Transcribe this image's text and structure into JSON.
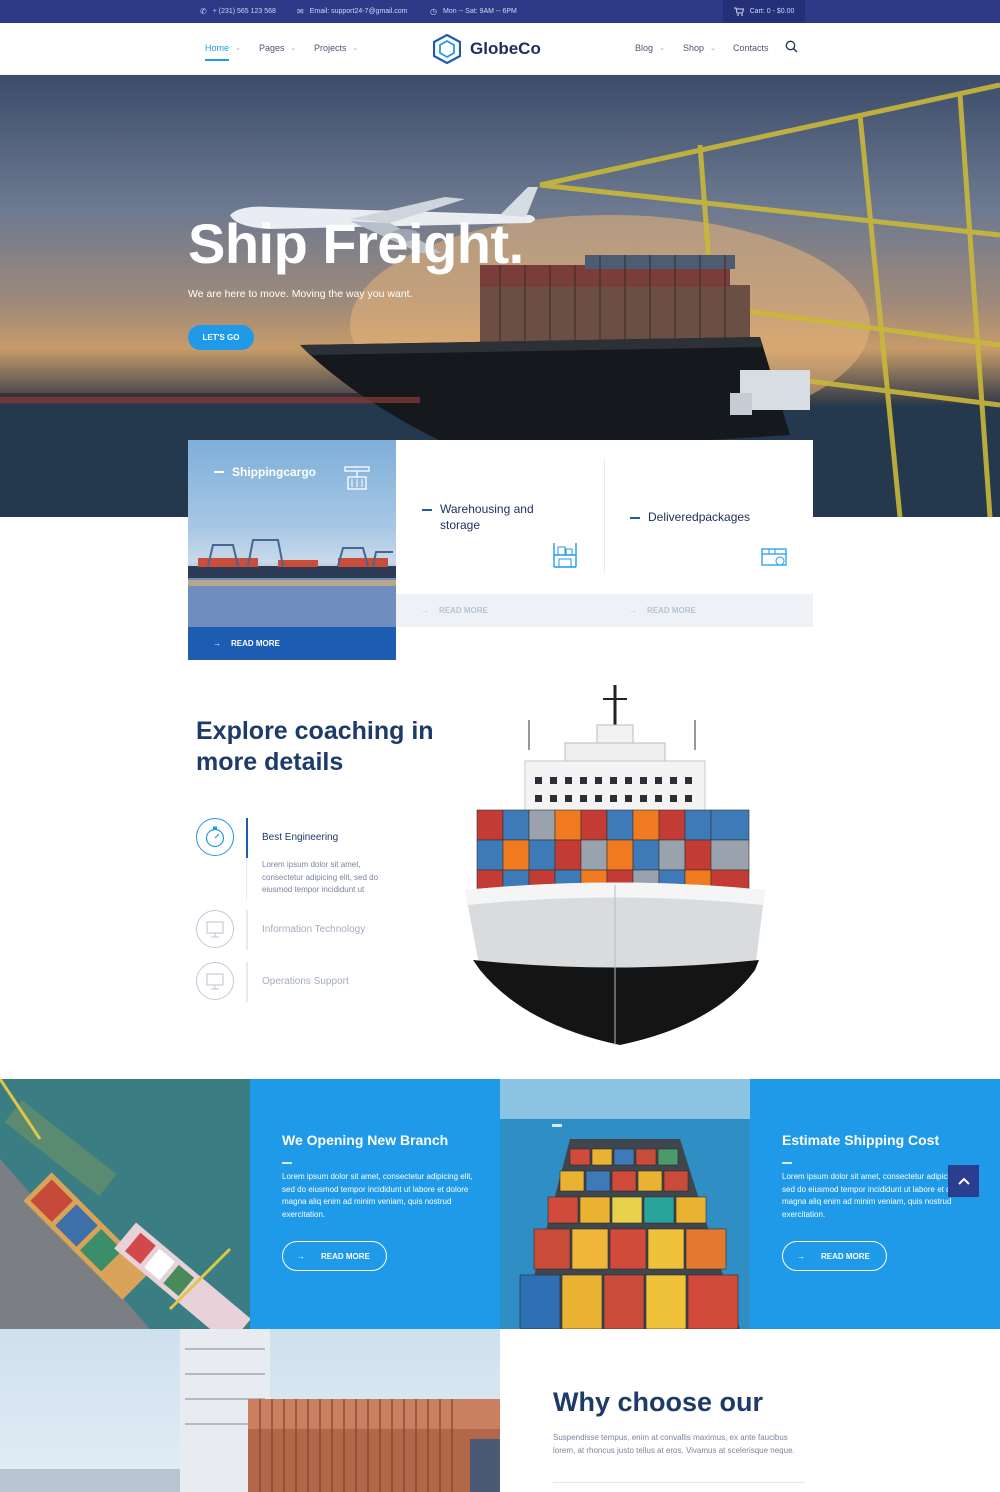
{
  "topbar": {
    "phone": "+ (231) 565 123 568",
    "email": "Email: support24-7@gmail.com",
    "hours": "Mon -- Sat: 9AM -- 6PM",
    "cart": "Cart: 0 - $0.00"
  },
  "nav": {
    "left": [
      {
        "label": "Home",
        "active": true
      },
      {
        "label": "Pages"
      },
      {
        "label": "Projects"
      }
    ],
    "right": [
      {
        "label": "Blog"
      },
      {
        "label": "Shop"
      },
      {
        "label": "Contacts"
      }
    ]
  },
  "brand": {
    "name": "GlobeCo"
  },
  "hero": {
    "title": "Ship Freight.",
    "subtitle": "We are here to move. Moving the way you want.",
    "cta": "LET'S GO"
  },
  "services": [
    {
      "title": "Shippingcargo",
      "read_more": "READ MORE"
    },
    {
      "title": "Warehousing and storage",
      "read_more": "READ MORE"
    },
    {
      "title": "Deliveredpackages",
      "read_more": "READ MORE"
    }
  ],
  "explore": {
    "title": "Explore coaching in more details",
    "features": [
      {
        "label": "Best Engineering",
        "active": true,
        "description": "Lorem ipsum dolor sit amet, consectetur adipicing elit, sed do eiusmod tempor incididunt ut"
      },
      {
        "label": "Information Technology"
      },
      {
        "label": "Operations Support"
      }
    ]
  },
  "tiles": [
    {
      "title": "We Opening New Branch",
      "text": "Lorem ipsum dolor sit amet, consectetur adipicing elit, sed do eiusmod tempor incididunt ut labore et dolore magna aliq enim ad minim veniam, quis nostrud exercitation.",
      "button": "READ MORE"
    },
    {
      "title": "Estimate Shipping Cost",
      "text": "Lorem ipsum dolor sit amet, consectetur adipicing elit, sed do eiusmod tempor incididunt ut labore et dolore magna aliq enim ad minim veniam, quis nostrud exercitation.",
      "button": "READ MORE"
    }
  ],
  "why": {
    "title": "Why choose our",
    "text": "Suspendisse tempus, enim at convallis maximus, ex ante faucibus lorem, at rhoncus justo tellus at eros. Vivamus at scelerisque neque."
  },
  "colors": {
    "topbar": "#2d3a87",
    "accent": "#1e9ae9",
    "dark_blue": "#1e5cb3",
    "heading": "#1d3a6b"
  }
}
